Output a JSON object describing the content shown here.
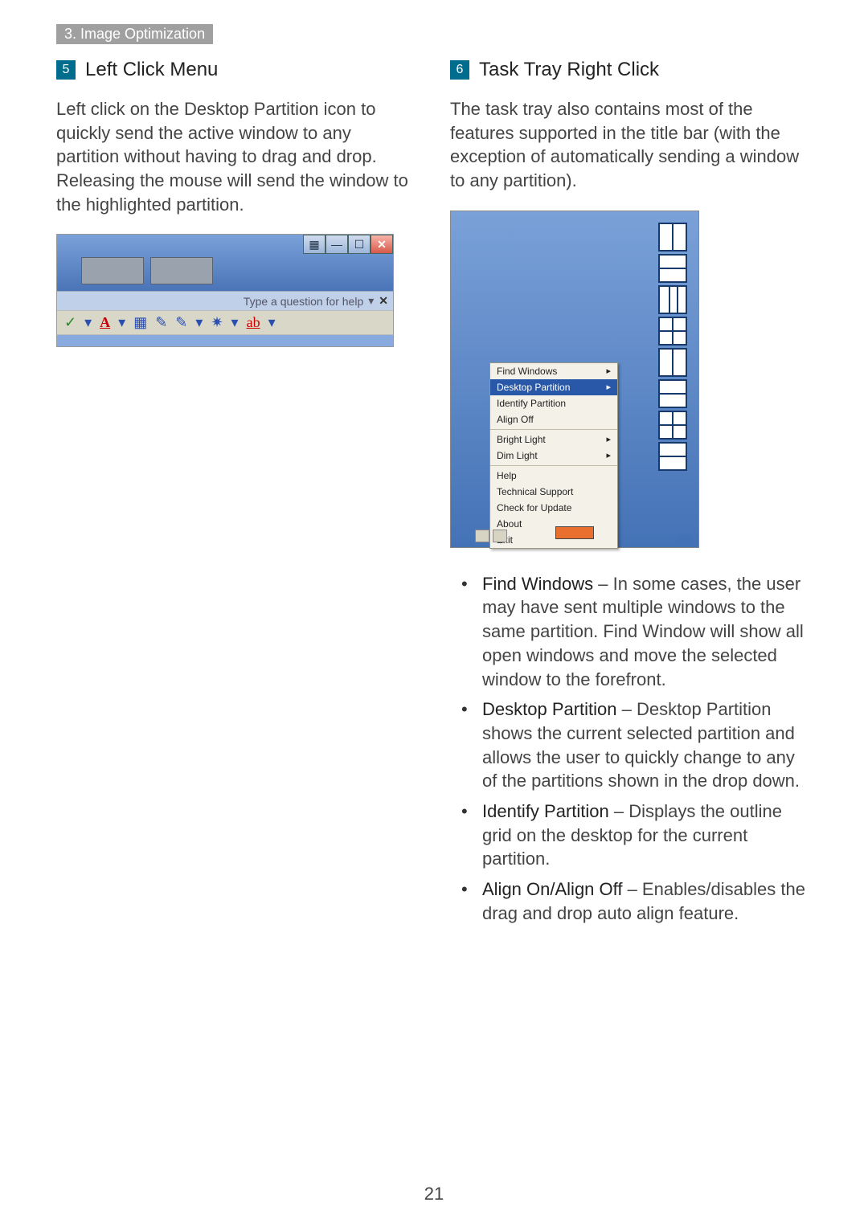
{
  "breadcrumb": "3. Image Optimization",
  "page_number": "21",
  "left": {
    "badge": "5",
    "title": "Left Click Menu",
    "body": "Left click on the Desktop Partition icon to quickly send the active window to any partition without having to drag and drop. Releasing the mouse will send the window to the highlighted partition.",
    "help_placeholder": "Type a question for help",
    "help_dropdown_glyph": "▾",
    "help_close": "✕",
    "tool_glyphs": {
      "check": "✓",
      "dash": "▾",
      "A": "A",
      "dash2": "▾",
      "bucket": "▦",
      "brush1": "✎",
      "brush2": "✎",
      "dash3": "▾",
      "star": "✷",
      "dash4": "▾",
      "ab": "ab",
      "dash5": "▾"
    }
  },
  "right": {
    "badge": "6",
    "title": "Task Tray Right Click",
    "body": "The task tray also contains most of the features supported in the title bar (with the exception of automatically sending a window to any partition).",
    "menu": {
      "find_windows": "Find Windows",
      "desktop_partition": "Desktop Partition",
      "identify_partition": "Identify Partition",
      "align_off": "Align Off",
      "bright_light": "Bright Light",
      "dim_light": "Dim Light",
      "help": "Help",
      "tech_support": "Technical Support",
      "check_update": "Check for Update",
      "about": "About",
      "exit": "Exit",
      "arrow": "▸"
    },
    "bullets": [
      {
        "term": "Find Windows",
        "text": " – In some cases, the user may have sent multiple windows to the same partition.  Find Window will show all open windows and move the selected window to the forefront."
      },
      {
        "term": "Desktop Partition",
        "text": " – Desktop Partition shows the current selected partition and allows the user to quickly change to any of the partitions shown in the drop down."
      },
      {
        "term": "Identify Partition",
        "text": " – Displays the outline grid on the desktop for the current partition."
      },
      {
        "term": "Align On/Align Off",
        "text": " – Enables/disables the drag and drop auto align feature."
      }
    ]
  }
}
